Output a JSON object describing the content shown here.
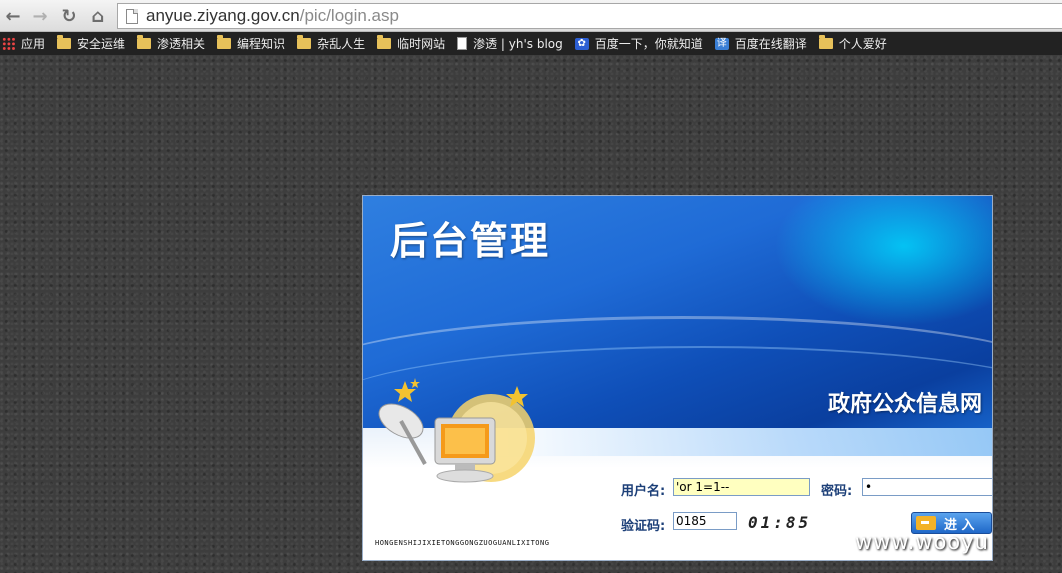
{
  "browser": {
    "url_host": "anyue.ziyang.gov.cn",
    "url_path": "/pic/login.asp",
    "bookmarks": [
      {
        "label": "应用",
        "icon": "apps-icon"
      },
      {
        "label": "安全运维",
        "icon": "folder-icon"
      },
      {
        "label": "渗透相关",
        "icon": "folder-icon"
      },
      {
        "label": "编程知识",
        "icon": "folder-icon"
      },
      {
        "label": "杂乱人生",
        "icon": "folder-icon"
      },
      {
        "label": "临时网站",
        "icon": "folder-icon"
      },
      {
        "label": "渗透 | yh's blog",
        "icon": "page-icon"
      },
      {
        "label": "百度一下，你就知道",
        "icon": "baidu-paw-icon"
      },
      {
        "label": "百度在线翻译",
        "icon": "translate-icon"
      },
      {
        "label": "个人爱好",
        "icon": "folder-icon"
      }
    ]
  },
  "login": {
    "title": "后台管理",
    "site_name": "政府公众信息网",
    "username_label": "用户名:",
    "username_value": "'or 1=1--",
    "password_label": "密码:",
    "password_value": "•",
    "captcha_label": "验证码:",
    "captcha_value": "0185",
    "captcha_image_text": "01:85",
    "enter_label": "进 入",
    "footer_caption": "HONGENSHIJIXIETONGGONGZUOGUANLIXITONG"
  },
  "watermark": "www.wooyu",
  "colors": {
    "banner_blue": "#1f6bd6",
    "username_bg": "#ffffc0",
    "label_color": "#1c3f78"
  }
}
